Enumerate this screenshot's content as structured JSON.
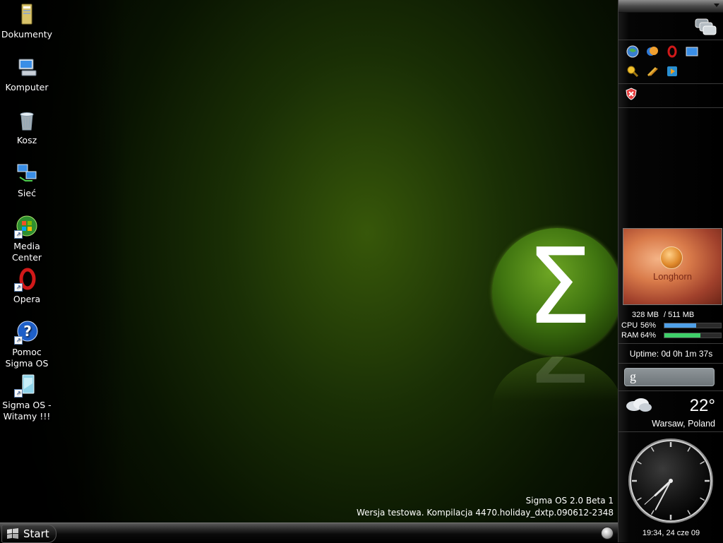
{
  "desktop": {
    "icons": [
      {
        "label": "Dokumenty",
        "icon": "documents-folder-icon"
      },
      {
        "label": "Komputer",
        "icon": "computer-icon"
      },
      {
        "label": "Kosz",
        "icon": "recycle-bin-icon"
      },
      {
        "label": "Sieć",
        "icon": "network-icon"
      },
      {
        "label": "Media Center",
        "icon": "media-center-icon"
      },
      {
        "label": "Opera",
        "icon": "opera-icon"
      },
      {
        "label": "Pomoc Sigma OS",
        "icon": "help-icon"
      },
      {
        "label": "Sigma OS - Witamy !!!",
        "icon": "welcome-icon"
      }
    ],
    "logo_symbol": "Σ",
    "version_line1": "Sigma OS 2.0 Beta 1",
    "version_line2": "Wersja testowa. Kompilacja 4470.holiday_dxtp.090612-2348"
  },
  "taskbar": {
    "start_label": "Start"
  },
  "sidebar": {
    "wallpaper_title": "Longhorn",
    "memory_used": "328 MB",
    "memory_total": "/ 511 MB",
    "cpu_label": "CPU",
    "cpu_value": "56%",
    "cpu_percent": 56,
    "ram_label": "RAM",
    "ram_value": "64%",
    "ram_percent": 64,
    "uptime": "Uptime: 0d 0h 1m 37s",
    "search_glyph": "g",
    "temperature": "22°",
    "location": "Warsaw, Poland",
    "clock_date": "19:34, 24 cze 09",
    "clock_hour": 19,
    "clock_minute": 34,
    "clock_second": 38
  },
  "colors": {
    "cpu_bar": "#4fa0e8",
    "ram_bar": "#3fcf6a",
    "desktop_green": "#3f7410"
  }
}
